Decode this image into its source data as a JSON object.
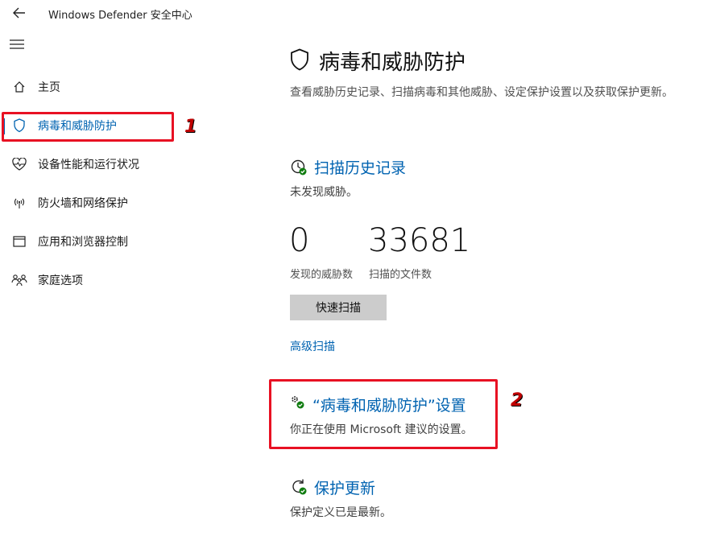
{
  "app": {
    "title": "Windows Defender 安全中心"
  },
  "sidebar": {
    "items": [
      {
        "label": "主页",
        "icon": "home-icon"
      },
      {
        "label": "病毒和威胁防护",
        "icon": "shield-icon",
        "active": true
      },
      {
        "label": "设备性能和运行状况",
        "icon": "heart-icon"
      },
      {
        "label": "防火墙和网络保护",
        "icon": "wifi-icon"
      },
      {
        "label": "应用和浏览器控制",
        "icon": "app-window-icon"
      },
      {
        "label": "家庭选项",
        "icon": "family-icon"
      }
    ]
  },
  "main": {
    "title": "病毒和威胁防护",
    "description": "查看威胁历史记录、扫描病毒和其他威胁、设定保护设置以及获取保护更新。",
    "scan_history": {
      "title": "扫描历史记录",
      "subtitle": "未发现威胁。",
      "threats_found": "0",
      "threats_found_label": "发现的威胁数",
      "files_scanned": "33681",
      "files_scanned_label": "扫描的文件数",
      "quick_scan_label": "快速扫描",
      "advanced_scan_label": "高级扫描"
    },
    "settings": {
      "title": "“病毒和威胁防护”设置",
      "subtitle": "你正在使用 Microsoft 建议的设置。"
    },
    "updates": {
      "title": "保护更新",
      "subtitle": "保护定义已是最新。"
    }
  },
  "annotations": {
    "marker1": "1",
    "marker2": "2"
  },
  "colors": {
    "accent": "#0063b1",
    "annotation": "#e81123",
    "status_ok": "#107c10"
  }
}
